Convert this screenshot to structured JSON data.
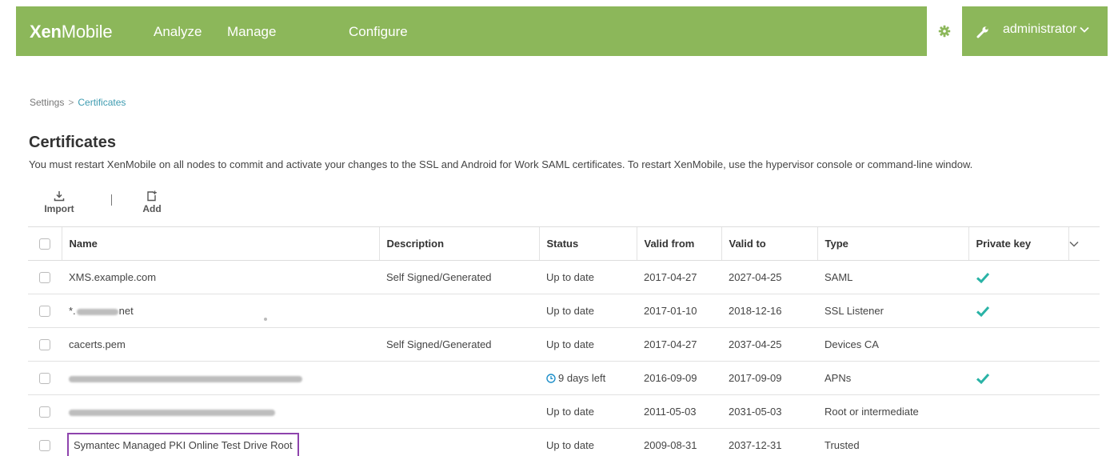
{
  "header": {
    "logo_bold": "Xen",
    "logo_light": "Mobile",
    "nav": [
      "Analyze",
      "Manage",
      "Configure"
    ],
    "user": "administrator",
    "settings_icon": "gear-icon",
    "tools_icon": "wrench-icon",
    "accent": "#8cb75a"
  },
  "breadcrumb": {
    "parent": "Settings",
    "separator": ">",
    "current": "Certificates"
  },
  "page": {
    "title": "Certificates",
    "notice": "You must restart XenMobile on all nodes to commit and activate your changes to the SSL and Android for Work SAML certificates. To restart XenMobile, use the hypervisor console or command-line window."
  },
  "toolbar": {
    "import_label": "Import",
    "add_label": "Add"
  },
  "table": {
    "columns": [
      "Name",
      "Description",
      "Status",
      "Valid from",
      "Valid to",
      "Type",
      "Private key"
    ],
    "rows": [
      {
        "name": "XMS.example.com",
        "description": "Self Signed/Generated",
        "status": "Up to date",
        "valid_from": "2017-04-27",
        "valid_to": "2027-04-25",
        "type": "SAML",
        "private_key": true
      },
      {
        "name": "*.        net",
        "description": "",
        "status": "Up to date",
        "valid_from": "2017-01-10",
        "valid_to": "2018-12-16",
        "type": "SSL Listener",
        "private_key": true
      },
      {
        "name": "cacerts.pem",
        "description": "Self Signed/Generated",
        "status": "Up to date",
        "valid_from": "2017-04-27",
        "valid_to": "2037-04-25",
        "type": "Devices CA",
        "private_key": false
      },
      {
        "name": "",
        "description": "",
        "status": "9 days left",
        "valid_from": "2016-09-09",
        "valid_to": "2017-09-09",
        "type": "APNs",
        "private_key": true
      },
      {
        "name": "",
        "description": "",
        "status": "Up to date",
        "valid_from": "2011-05-03",
        "valid_to": "2031-05-03",
        "type": "Root or intermediate",
        "private_key": false
      },
      {
        "name": "Symantec Managed PKI Online Test Drive Root",
        "description": "",
        "status": "Up to date",
        "valid_from": "2009-08-31",
        "valid_to": "2037-12-31",
        "type": "Trusted",
        "private_key": false
      }
    ],
    "check_color": "#2ab3a6",
    "highlight_color": "#8e44ad"
  }
}
